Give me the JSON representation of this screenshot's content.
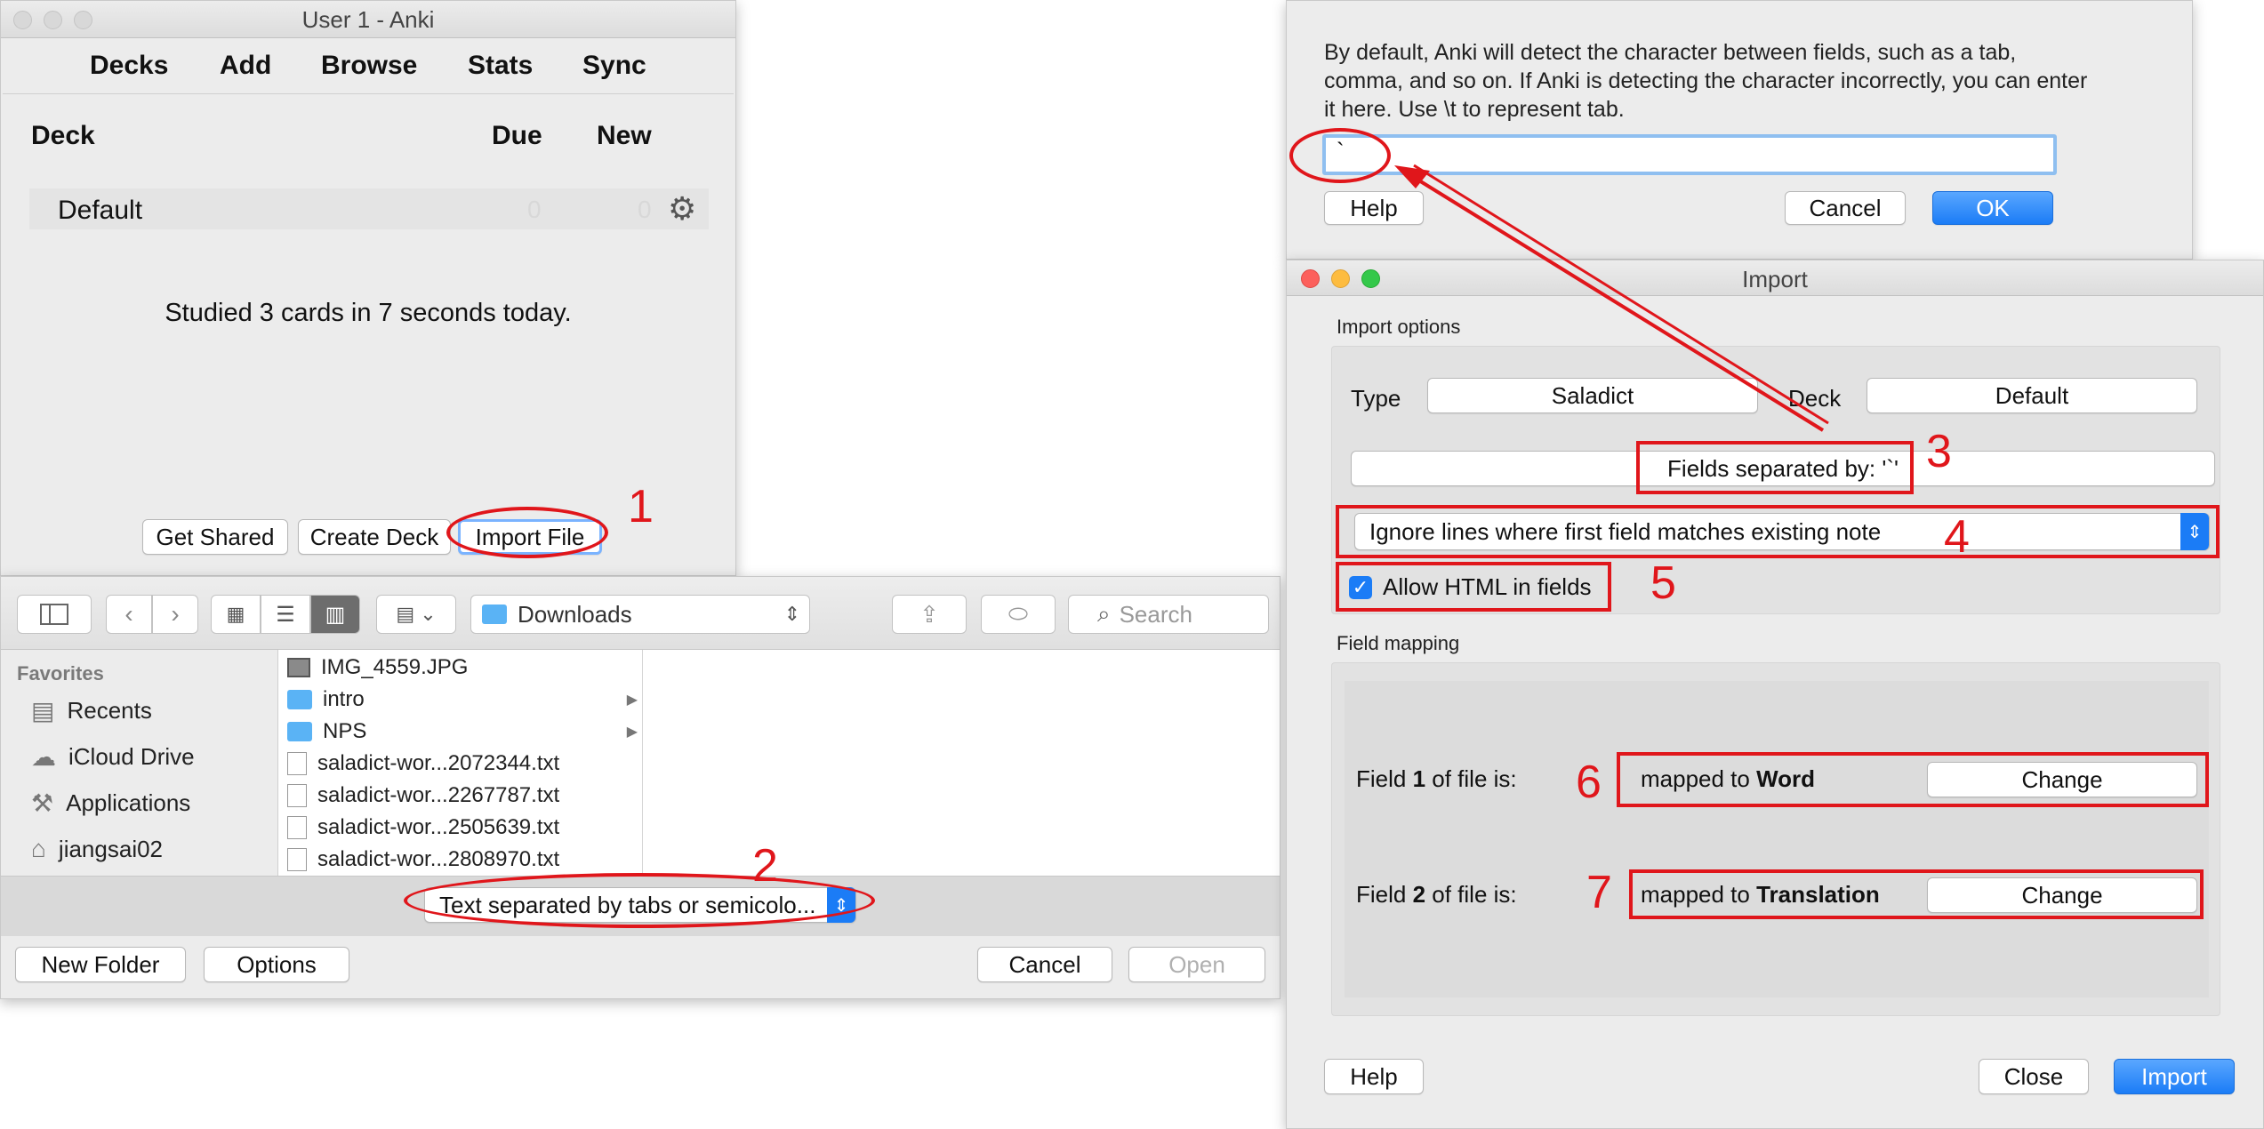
{
  "anki": {
    "title": "User 1 - Anki",
    "menu": [
      "Decks",
      "Add",
      "Browse",
      "Stats",
      "Sync"
    ],
    "columns": {
      "deck": "Deck",
      "due": "Due",
      "new": "New"
    },
    "deck_row": {
      "name": "Default",
      "due": "0",
      "new": "0"
    },
    "studied": "Studied 3 cards in 7 seconds today.",
    "buttons": {
      "get_shared": "Get Shared",
      "create_deck": "Create Deck",
      "import_file": "Import File"
    }
  },
  "finder": {
    "location": "Downloads",
    "search_placeholder": "Search",
    "sidebar_heading": "Favorites",
    "sidebar": [
      {
        "label": "Recents",
        "icon": "recents-icon"
      },
      {
        "label": "iCloud Drive",
        "icon": "cloud-icon"
      },
      {
        "label": "Applications",
        "icon": "applications-icon"
      },
      {
        "label": "jiangsai02",
        "icon": "home-icon"
      }
    ],
    "files": [
      {
        "name": "IMG_4559.JPG",
        "kind": "image"
      },
      {
        "name": "intro",
        "kind": "folder"
      },
      {
        "name": "NPS",
        "kind": "folder"
      },
      {
        "name": "saladict-wor...2072344.txt",
        "kind": "file"
      },
      {
        "name": "saladict-wor...2267787.txt",
        "kind": "file"
      },
      {
        "name": "saladict-wor...2505639.txt",
        "kind": "file"
      },
      {
        "name": "saladict-wor...2808970.txt",
        "kind": "file"
      }
    ],
    "format": "Text separated by tabs or semicolo...",
    "buttons": {
      "new_folder": "New Folder",
      "options": "Options",
      "cancel": "Cancel",
      "open": "Open"
    }
  },
  "separator_dialog": {
    "message": "By default, Anki will detect the character between fields, such as a tab, comma, and so on. If Anki is detecting the character incorrectly, you can enter it here. Use \\t to represent tab.",
    "value": "`",
    "buttons": {
      "help": "Help",
      "cancel": "Cancel",
      "ok": "OK"
    }
  },
  "import_dialog": {
    "title": "Import",
    "options_heading": "Import options",
    "type_label": "Type",
    "type_value": "Saladict",
    "deck_label": "Deck",
    "deck_value": "Default",
    "separator_button": "Fields separated by: '`'",
    "duplicate_mode": "Ignore lines where first field matches existing note",
    "allow_html": "Allow HTML in fields",
    "mapping_heading": "Field mapping",
    "mappings": [
      {
        "pre": "Field ",
        "num": "1",
        "post": " of file is:",
        "mapped_prefix": "mapped to ",
        "target": "Word",
        "change": "Change"
      },
      {
        "pre": "Field ",
        "num": "2",
        "post": " of file is:",
        "mapped_prefix": "mapped to ",
        "target": "Translation",
        "change": "Change"
      }
    ],
    "buttons": {
      "help": "Help",
      "close": "Close",
      "import": "Import"
    }
  },
  "annotations": [
    "1",
    "2",
    "3",
    "4",
    "5",
    "6",
    "7"
  ],
  "colors": {
    "annotation": "#e0161b",
    "accent": "#1b7cf6"
  }
}
